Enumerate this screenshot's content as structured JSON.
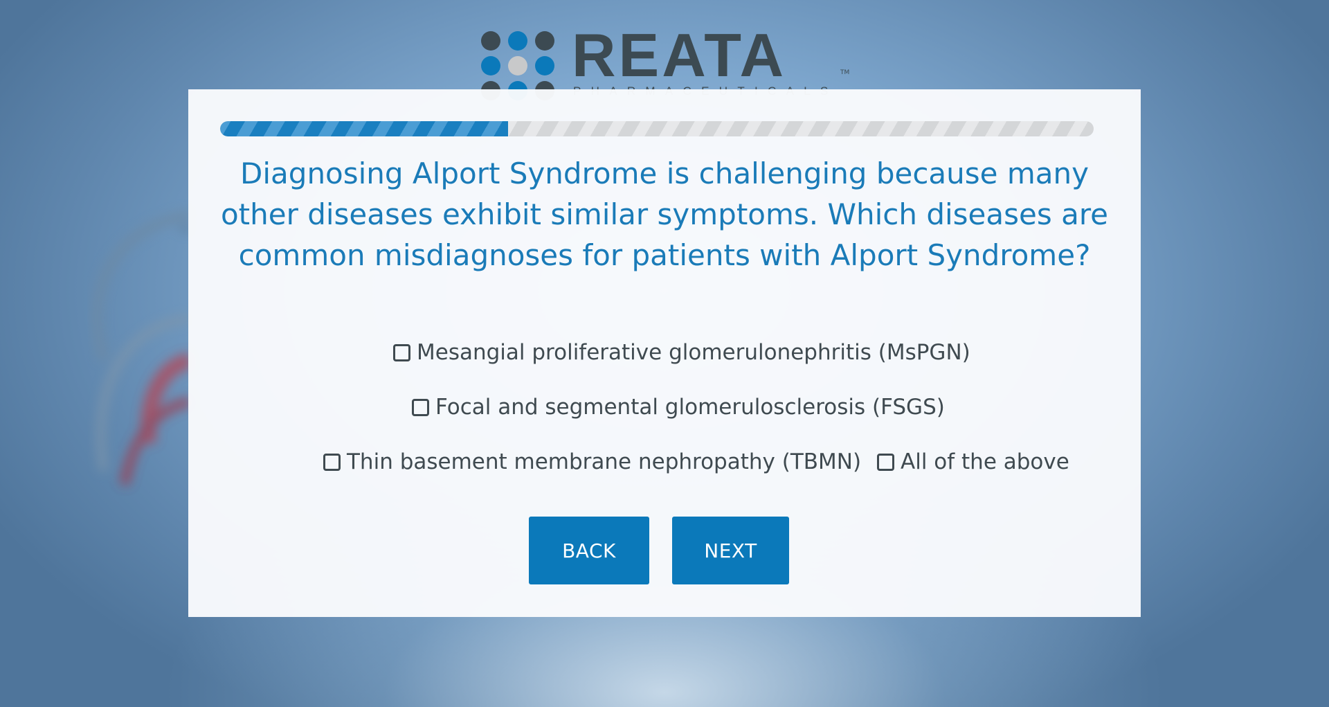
{
  "brand": {
    "name": "REATA",
    "trademark": "TM",
    "tagline": "PHARMACEUTICALS"
  },
  "progress": {
    "fraction": 0.33,
    "color": "#1a7fc0"
  },
  "question": {
    "text": "Diagnosing Alport Syndrome is challenging because many other diseases exhibit similar symptoms. Which diseases are common misdiagnoses for patients with Alport Syndrome?"
  },
  "options": [
    {
      "label": "Mesangial proliferative glomerulonephritis (MsPGN)",
      "checked": false
    },
    {
      "label": "Focal and segmental glomerulosclerosis (FSGS)",
      "checked": false
    },
    {
      "label": "Thin basement membrane nephropathy (TBMN)",
      "checked": false
    },
    {
      "label": "All of the above",
      "checked": false
    }
  ],
  "buttons": {
    "back_label": "BACK",
    "next_label": "NEXT"
  },
  "colors": {
    "accent": "#0b79ba",
    "question_text": "#1a7bb8",
    "body_text": "#3f4a50",
    "logo_dark": "#3c4a52",
    "logo_light": "#c8c9ca"
  }
}
